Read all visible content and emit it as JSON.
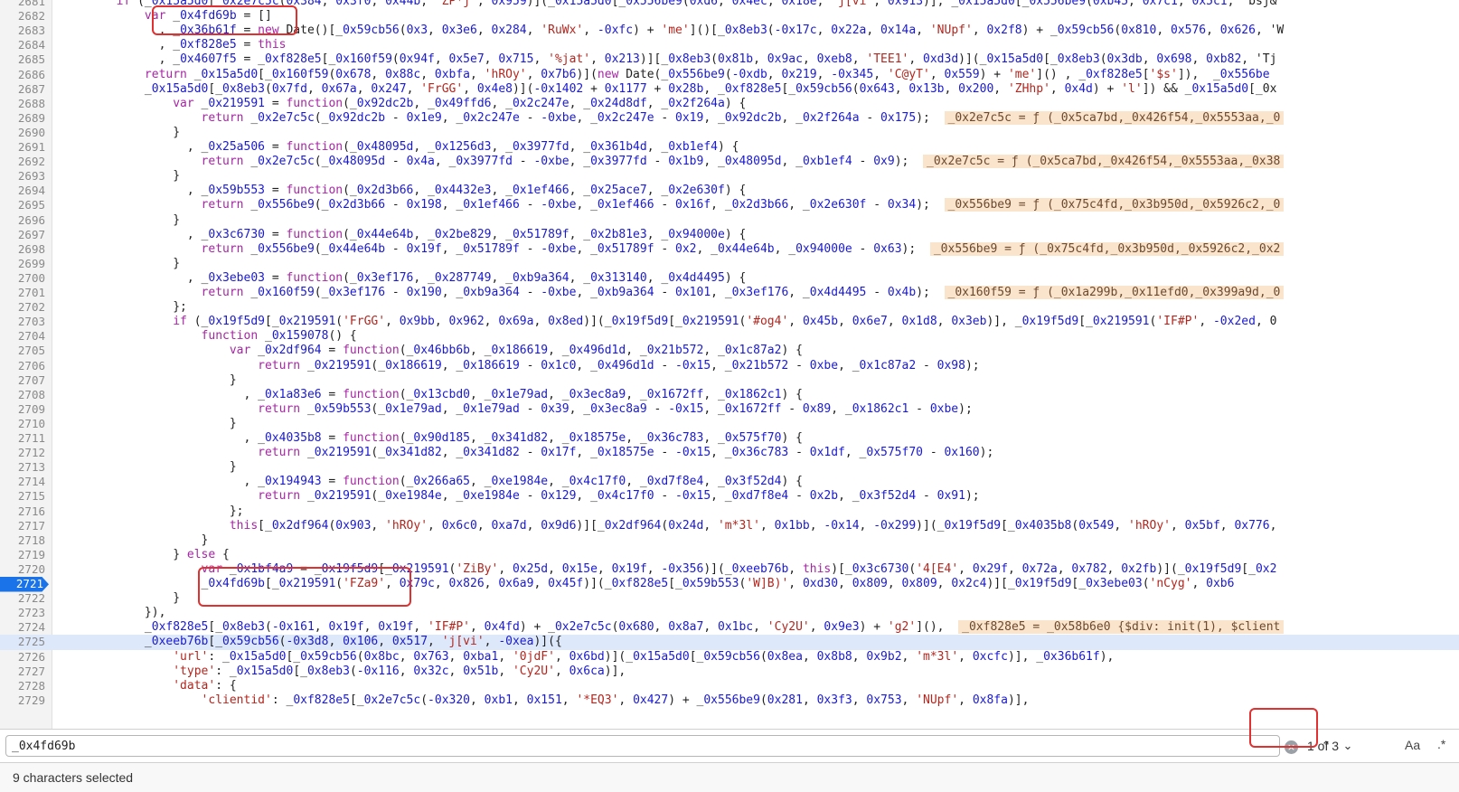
{
  "editor": {
    "lines": [
      {
        "n": "2681",
        "t": "        if (_0x15a5d0[_0x2e7c5c(0x384, 0x3f0, 0x44b, 'ZP*j', 0x959)](_0x15a5d0[_0x556be9(0xd6, 0x4ec, 0x18e, 'j[vi', 0x913)], _0x15a5d0[_0x556be9(0xb45, 0x7c1, 0x5c1, 'bsj&"
      },
      {
        "n": "2682",
        "t": "            var _0x4fd69b = []"
      },
      {
        "n": "2683",
        "t": "              , _0x36b61f = new Date()[_0x59cb56(0x3, 0x3e6, 0x284, 'RuWx', -0xfc) + 'me']()[_0x8eb3(-0x17c, 0x22a, 0x14a, 'NUpf', 0x2f8) + _0x59cb56(0x810, 0x576, 0x626, 'W"
      },
      {
        "n": "2684",
        "t": "              , _0xf828e5 = this"
      },
      {
        "n": "2685",
        "t": "              , _0x4607f5 = _0xf828e5[_0x160f59(0x94f, 0x5e7, 0x715, '%jat', 0x213)][_0x8eb3(0x81b, 0x9ac, 0xeb8, 'TEE1', 0xd3d)](_0x15a5d0[_0x8eb3(0x3db, 0x698, 0xb82, 'Tj"
      },
      {
        "n": "2686",
        "t": "            return _0x15a5d0[_0x160f59(0x678, 0x88c, 0xbfa, 'hROy', 0x7b6)](new Date(_0x556be9(-0xdb, 0x219, -0x345, 'C@yT', 0x559) + 'me']() , _0xf828e5['$s']),  _0x556be"
      },
      {
        "n": "2687",
        "t": "            _0x15a5d0[_0x8eb3(0x7fd, 0x67a, 0x247, 'FrGG', 0x4e8)](-0x1402 + 0x1177 + 0x28b, _0xf828e5[_0x59cb56(0x643, 0x13b, 0x200, 'ZHhp', 0x4d) + 'l']) && _0x15a5d0[_0x"
      },
      {
        "n": "2688",
        "t": "                var _0x219591 = function(_0x92dc2b, _0x49ffd6, _0x2c247e, _0x24d8df, _0x2f264a) {"
      },
      {
        "n": "2689",
        "t": "                    return _0x2e7c5c(_0x92dc2b - 0x1e9, _0x2c247e - -0xbe, _0x2c247e - 0x19, _0x92dc2b, _0x2f264a - 0x175);  ",
        "i": "_0x2e7c5c = ƒ (_0x5ca7bd,_0x426f54,_0x5553aa,_0"
      },
      {
        "n": "2690",
        "t": "                }"
      },
      {
        "n": "2691",
        "t": "                  , _0x25a506 = function(_0x48095d, _0x1256d3, _0x3977fd, _0x361b4d, _0xb1ef4) {"
      },
      {
        "n": "2692",
        "t": "                    return _0x2e7c5c(_0x48095d - 0x4a, _0x3977fd - -0xbe, _0x3977fd - 0x1b9, _0x48095d, _0xb1ef4 - 0x9);  ",
        "i": "_0x2e7c5c = ƒ (_0x5ca7bd,_0x426f54,_0x5553aa,_0x38"
      },
      {
        "n": "2693",
        "t": "                }"
      },
      {
        "n": "2694",
        "t": "                  , _0x59b553 = function(_0x2d3b66, _0x4432e3, _0x1ef466, _0x25ace7, _0x2e630f) {"
      },
      {
        "n": "2695",
        "t": "                    return _0x556be9(_0x2d3b66 - 0x198, _0x1ef466 - -0xbe, _0x1ef466 - 0x16f, _0x2d3b66, _0x2e630f - 0x34);  ",
        "i": "_0x556be9 = ƒ (_0x75c4fd,_0x3b950d,_0x5926c2,_0"
      },
      {
        "n": "2696",
        "t": "                }"
      },
      {
        "n": "2697",
        "t": "                  , _0x3c6730 = function(_0x44e64b, _0x2be829, _0x51789f, _0x2b81e3, _0x94000e) {"
      },
      {
        "n": "2698",
        "t": "                    return _0x556be9(_0x44e64b - 0x19f, _0x51789f - -0xbe, _0x51789f - 0x2, _0x44e64b, _0x94000e - 0x63);  ",
        "i": "_0x556be9 = ƒ (_0x75c4fd,_0x3b950d,_0x5926c2,_0x2"
      },
      {
        "n": "2699",
        "t": "                }"
      },
      {
        "n": "2700",
        "t": "                  , _0x3ebe03 = function(_0x3ef176, _0x287749, _0xb9a364, _0x313140, _0x4d4495) {"
      },
      {
        "n": "2701",
        "t": "                    return _0x160f59(_0x3ef176 - 0x190, _0xb9a364 - -0xbe, _0xb9a364 - 0x101, _0x3ef176, _0x4d4495 - 0x4b);  ",
        "i": "_0x160f59 = ƒ (_0x1a299b,_0x11efd0,_0x399a9d,_0"
      },
      {
        "n": "2702",
        "t": "                };"
      },
      {
        "n": "2703",
        "t": "                if (_0x19f5d9[_0x219591('FrGG', 0x9bb, 0x962, 0x69a, 0x8ed)](_0x19f5d9[_0x219591('#og4', 0x45b, 0x6e7, 0x1d8, 0x3eb)], _0x19f5d9[_0x219591('IF#P', -0x2ed, 0"
      },
      {
        "n": "2704",
        "t": "                    function _0x159078() {"
      },
      {
        "n": "2705",
        "t": "                        var _0x2df964 = function(_0x46bb6b, _0x186619, _0x496d1d, _0x21b572, _0x1c87a2) {"
      },
      {
        "n": "2706",
        "t": "                            return _0x219591(_0x186619, _0x186619 - 0x1c0, _0x496d1d - -0x15, _0x21b572 - 0xbe, _0x1c87a2 - 0x98);"
      },
      {
        "n": "2707",
        "t": "                        }"
      },
      {
        "n": "2708",
        "t": "                          , _0x1a83e6 = function(_0x13cbd0, _0x1e79ad, _0x3ec8a9, _0x1672ff, _0x1862c1) {"
      },
      {
        "n": "2709",
        "t": "                            return _0x59b553(_0x1e79ad, _0x1e79ad - 0x39, _0x3ec8a9 - -0x15, _0x1672ff - 0x89, _0x1862c1 - 0xbe);"
      },
      {
        "n": "2710",
        "t": "                        }"
      },
      {
        "n": "2711",
        "t": "                          , _0x4035b8 = function(_0x90d185, _0x341d82, _0x18575e, _0x36c783, _0x575f70) {"
      },
      {
        "n": "2712",
        "t": "                            return _0x219591(_0x341d82, _0x341d82 - 0x17f, _0x18575e - -0x15, _0x36c783 - 0x1df, _0x575f70 - 0x160);"
      },
      {
        "n": "2713",
        "t": "                        }"
      },
      {
        "n": "2714",
        "t": "                          , _0x194943 = function(_0x266a65, _0xe1984e, _0x4c17f0, _0xd7f8e4, _0x3f52d4) {"
      },
      {
        "n": "2715",
        "t": "                            return _0x219591(_0xe1984e, _0xe1984e - 0x129, _0x4c17f0 - -0x15, _0xd7f8e4 - 0x2b, _0x3f52d4 - 0x91);"
      },
      {
        "n": "2716",
        "t": "                        };"
      },
      {
        "n": "2717",
        "t": "                        this[_0x2df964(0x903, 'hROy', 0x6c0, 0xa7d, 0x9d6)][_0x2df964(0x24d, 'm*3l', 0x1bb, -0x14, -0x299)](_0x19f5d9[_0x4035b8(0x549, 'hROy', 0x5bf, 0x776,"
      },
      {
        "n": "2718",
        "t": "                    }"
      },
      {
        "n": "2719",
        "t": "                } else {"
      },
      {
        "n": "2720",
        "t": "                    var _0x1bf4a9 = _0x19f5d9[_0x219591('ZiBy', 0x25d, 0x15e, 0x19f, -0x356)](_0xeeb76b, this)[_0x3c6730('4[E4', 0x29f, 0x72a, 0x782, 0x2fb)](_0x19f5d9[_0x2"
      },
      {
        "n": "2721",
        "t": "                    _0x4fd69b[_0x219591('FZa9', 0x79c, 0x826, 0x6a9, 0x45f)](_0xf828e5[_0x59b553('W]B)', 0xd30, 0x809, 0x809, 0x2c4)][_0x19f5d9[_0x3ebe03('nCyg', 0xb6"
      },
      {
        "n": "2722",
        "t": "                }"
      },
      {
        "n": "2723",
        "t": "            }),"
      },
      {
        "n": "2724",
        "t": "            _0xf828e5[_0x8eb3(-0x161, 0x19f, 0x19f, 'IF#P', 0x4fd) + _0x2e7c5c(0x680, 0x8a7, 0x1bc, 'Cy2U', 0x9e3) + 'g2'](),  ",
        "i": "_0xf828e5 = _0x58b6e0 {$div: init(1), $client"
      },
      {
        "n": "2725",
        "t": "            _0xeeb76b[_0x59cb56(-0x3d8, 0x106, 0x517, 'j[vi', -0xea)]({"
      },
      {
        "n": "2726",
        "t": "                'url': _0x15a5d0[_0x59cb56(0x8bc, 0x763, 0xba1, '0jdF', 0x6bd)](_0x15a5d0[_0x59cb56(0x8ea, 0x8b8, 0x9b2, 'm*3l', 0xcfc)], _0x36b61f),"
      },
      {
        "n": "2727",
        "t": "                'type': _0x15a5d0[_0x8eb3(-0x116, 0x32c, 0x51b, 'Cy2U', 0x6ca)],"
      },
      {
        "n": "2728",
        "t": "                'data': {"
      },
      {
        "n": "2729",
        "t": "                    'clientid': _0xf828e5[_0x2e7c5c(-0x320, 0xb1, 0x151, '*EQ3', 0x427) + _0x556be9(0x281, 0x3f3, 0x753, 'NUpf', 0x8fa)],"
      }
    ],
    "breakpoint_line": "2721",
    "active_line": "2725",
    "highlight_token": "_0x4fd69b",
    "selected_token": "_0x59cb56"
  },
  "search": {
    "query": "_0x4fd69b",
    "match_count": "1 of 3",
    "clear_icon": "×",
    "prev_icon": "⌃",
    "next_icon": "⌄",
    "case_label": "Aa",
    "regex_label": ".*"
  },
  "status": {
    "text": "9 characters selected"
  },
  "colors": {
    "keyword": "#a626a4",
    "number": "#1a1acf",
    "string": "#b3261e",
    "match_highlight": "#f7ec3b",
    "breakpoint": "#1a73e8",
    "annotation_box": "#e03030"
  }
}
